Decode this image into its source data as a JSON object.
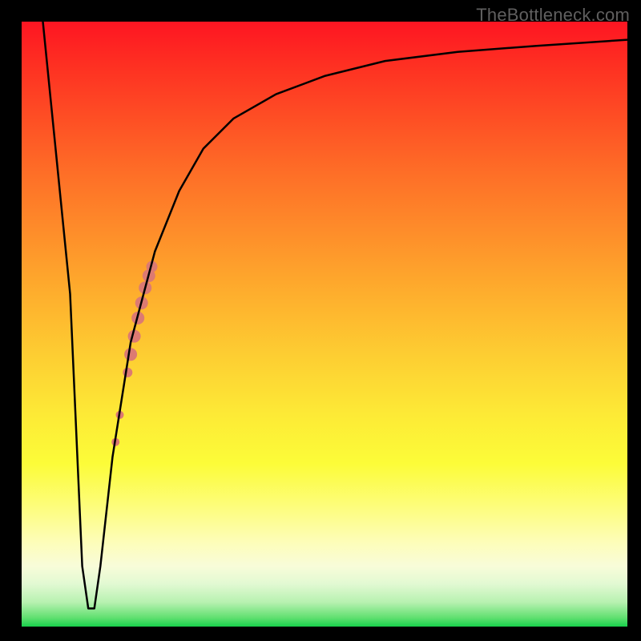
{
  "watermark": "TheBottleneck.com",
  "chart_data": {
    "type": "line",
    "title": "",
    "xlabel": "",
    "ylabel": "",
    "xlim": [
      0,
      100
    ],
    "ylim": [
      0,
      100
    ],
    "grid": false,
    "legend": false,
    "series": [
      {
        "name": "bottleneck-curve",
        "x": [
          3.5,
          8,
          10,
          11,
          12,
          13,
          15,
          18,
          22,
          26,
          30,
          35,
          42,
          50,
          60,
          72,
          85,
          100
        ],
        "y": [
          100,
          55,
          10,
          3,
          3,
          10,
          28,
          47,
          62,
          72,
          79,
          84,
          88,
          91,
          93.5,
          95,
          96,
          97
        ]
      }
    ],
    "dots": {
      "name": "highlight-dots",
      "color": "#dc7a72",
      "points": [
        {
          "x": 15.5,
          "y": 30.5,
          "r": 5
        },
        {
          "x": 16.2,
          "y": 35,
          "r": 5
        },
        {
          "x": 17.5,
          "y": 42,
          "r": 6
        },
        {
          "x": 18.0,
          "y": 45,
          "r": 8
        },
        {
          "x": 18.6,
          "y": 48,
          "r": 8
        },
        {
          "x": 19.2,
          "y": 51,
          "r": 8
        },
        {
          "x": 19.8,
          "y": 53.5,
          "r": 8
        },
        {
          "x": 20.4,
          "y": 56,
          "r": 8
        },
        {
          "x": 21.0,
          "y": 58,
          "r": 8
        },
        {
          "x": 21.5,
          "y": 59.5,
          "r": 7
        }
      ]
    },
    "gradient_stops": [
      {
        "pos": 0,
        "color": "#fe1522"
      },
      {
        "pos": 65,
        "color": "#fdea36"
      },
      {
        "pos": 100,
        "color": "#18d14c"
      }
    ]
  }
}
